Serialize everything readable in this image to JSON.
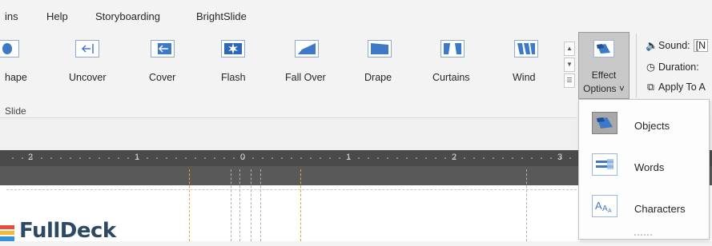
{
  "menu": {
    "tab_partial": "ins",
    "help": "Help",
    "storyboarding": "Storyboarding",
    "brightslide": "BrightSlide"
  },
  "gallery": {
    "items": [
      {
        "label": "hape"
      },
      {
        "label": "Uncover"
      },
      {
        "label": "Cover"
      },
      {
        "label": "Flash"
      },
      {
        "label": "Fall Over"
      },
      {
        "label": "Drape"
      },
      {
        "label": "Curtains"
      },
      {
        "label": "Wind"
      }
    ]
  },
  "effect_options": {
    "line1": "Effect",
    "line2": "Options ˅"
  },
  "timing": {
    "sound_label": "Sound:",
    "sound_value": "[N",
    "duration_label": "Duration:",
    "apply_label": "Apply To A"
  },
  "group": {
    "label": "Slide"
  },
  "ruler": {
    "marks": [
      "2",
      "1",
      "0",
      "1",
      "2",
      "3"
    ]
  },
  "logo": {
    "text": "FullDeck"
  },
  "dropdown": {
    "items": [
      {
        "label": "Objects",
        "selected": true
      },
      {
        "label": "Words",
        "selected": false
      },
      {
        "label": "Characters",
        "selected": false
      }
    ]
  },
  "colors": {
    "accent_blue": "#3d79c6",
    "guide_orange": "#f0a030",
    "ruler_dark": "#4a4a4a"
  }
}
